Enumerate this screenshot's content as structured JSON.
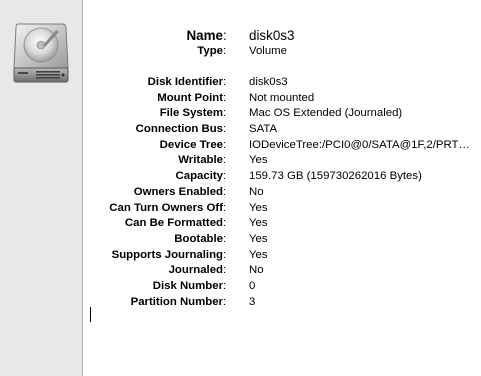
{
  "header": {
    "name_label": "Name",
    "name_value": "disk0s3",
    "type_label": "Type",
    "type_value": "Volume"
  },
  "colon": ":",
  "properties": [
    {
      "label": "Disk Identifier",
      "value": "disk0s3"
    },
    {
      "label": "Mount Point",
      "value": "Not mounted"
    },
    {
      "label": "File System",
      "value": "Mac OS Extended (Journaled)"
    },
    {
      "label": "Connection Bus",
      "value": "SATA"
    },
    {
      "label": "Device Tree",
      "value": "IODeviceTree:/PCI0@0/SATA@1F,2/PRT…"
    },
    {
      "label": "Writable",
      "value": "Yes"
    },
    {
      "label": "Capacity",
      "value": "159.73 GB (159730262016 Bytes)"
    },
    {
      "label": "Owners Enabled",
      "value": "No"
    },
    {
      "label": "Can Turn Owners Off",
      "value": "Yes"
    },
    {
      "label": "Can Be Formatted",
      "value": "Yes"
    },
    {
      "label": "Bootable",
      "value": "Yes"
    },
    {
      "label": "Supports Journaling",
      "value": "Yes"
    },
    {
      "label": "Journaled",
      "value": "No"
    },
    {
      "label": "Disk Number",
      "value": "0"
    },
    {
      "label": "Partition Number",
      "value": "3"
    }
  ],
  "icons": {
    "disk": "hard-disk-icon"
  }
}
